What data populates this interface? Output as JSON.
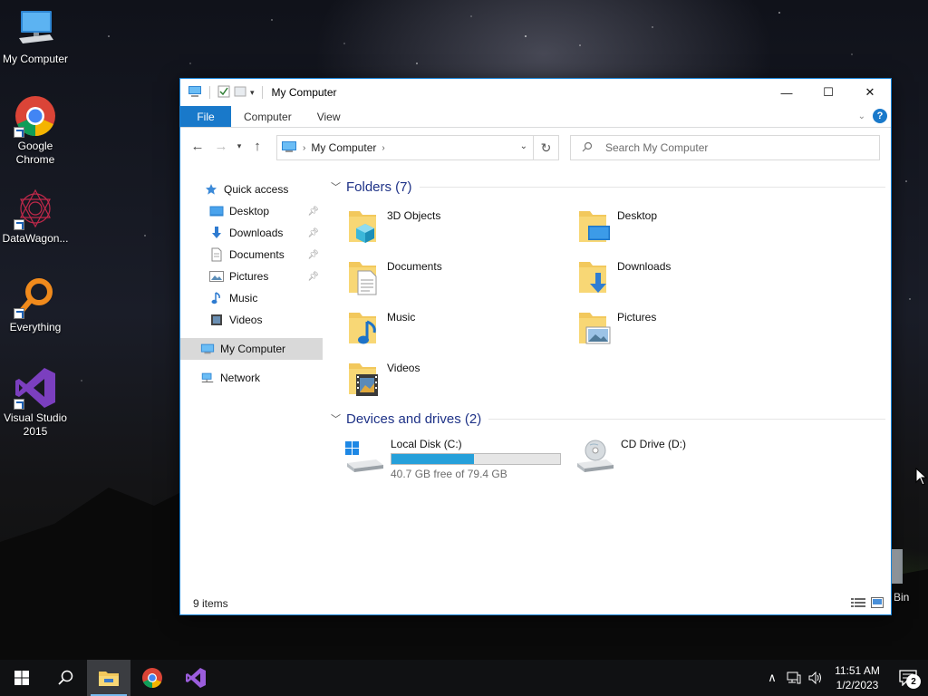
{
  "desktop": {
    "icons": [
      {
        "label": "My Computer",
        "icon": "computer-icon"
      },
      {
        "label": "Google Chrome",
        "icon": "chrome-icon"
      },
      {
        "label": "DataWagon...",
        "icon": "datawagon-icon"
      },
      {
        "label": "Everything",
        "icon": "everything-icon"
      },
      {
        "label": "Visual Studio 2015",
        "icon": "visual-studio-icon"
      }
    ],
    "recycle_bin_label": "Bin"
  },
  "window": {
    "title": "My Computer",
    "controls": {
      "minimize": "—",
      "maximize": "☐",
      "close": "✕"
    }
  },
  "ribbon": {
    "tabs": [
      "File",
      "Computer",
      "View"
    ]
  },
  "navigation": {
    "address_root_icon": "computer-icon",
    "address_crumb": "My Computer",
    "search_placeholder": "Search My Computer"
  },
  "sidebar": {
    "quick_access": "Quick access",
    "items": [
      {
        "label": "Desktop",
        "icon": "desktop-icon",
        "pinned": true
      },
      {
        "label": "Downloads",
        "icon": "download-icon",
        "pinned": true
      },
      {
        "label": "Documents",
        "icon": "document-icon",
        "pinned": true
      },
      {
        "label": "Pictures",
        "icon": "pictures-icon",
        "pinned": true
      },
      {
        "label": "Music",
        "icon": "music-icon",
        "pinned": false
      },
      {
        "label": "Videos",
        "icon": "videos-icon",
        "pinned": false
      }
    ],
    "my_computer": "My Computer",
    "network": "Network"
  },
  "content": {
    "folders_header": "Folders (7)",
    "folders": [
      {
        "name": "3D Objects",
        "overlay": "cube"
      },
      {
        "name": "Desktop",
        "overlay": "monitor"
      },
      {
        "name": "Documents",
        "overlay": "doc"
      },
      {
        "name": "Downloads",
        "overlay": "arrow"
      },
      {
        "name": "Music",
        "overlay": "note"
      },
      {
        "name": "Pictures",
        "overlay": "photo"
      },
      {
        "name": "Videos",
        "overlay": "film"
      }
    ],
    "drives_header": "Devices and drives (2)",
    "drives": [
      {
        "name": "Local Disk (C:)",
        "free_text": "40.7 GB free of 79.4 GB",
        "used_fraction": 0.487,
        "type": "hdd"
      },
      {
        "name": "CD Drive (D:)",
        "type": "cd"
      }
    ]
  },
  "status": {
    "items_count": "9 items"
  },
  "taskbar": {
    "clock_time": "11:51 AM",
    "clock_date": "1/2/2023",
    "notification_count": "2"
  },
  "colors": {
    "accent": "#1979ca",
    "group_header": "#1e3287",
    "capacity_fill": "#26a0da"
  }
}
